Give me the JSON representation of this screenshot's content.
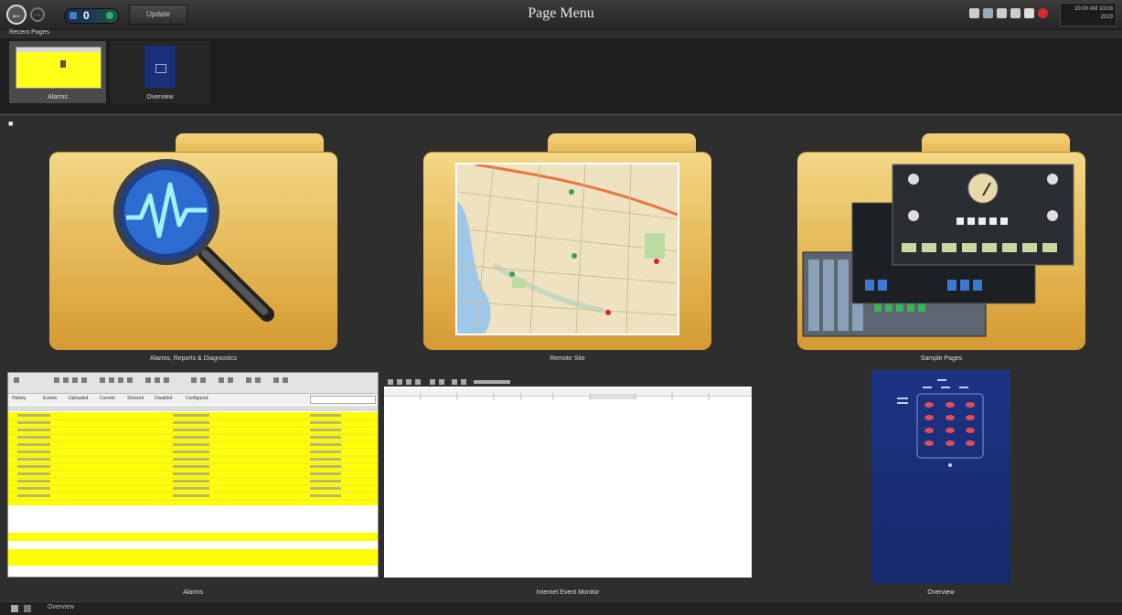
{
  "window": {
    "title": "Page Menu"
  },
  "toolbar": {
    "back_icon": "back-arrow-icon",
    "forward_icon": "forward-arrow-icon",
    "alarm_count": "0",
    "button_label": "Update"
  },
  "clock": {
    "time": "10:00 AM  10/18",
    "date": "2023"
  },
  "recent": {
    "label": "Recent Pages",
    "items": [
      {
        "label": "Alarms"
      },
      {
        "label": "Overview"
      }
    ]
  },
  "folders": [
    {
      "label": "Alarms, Reports & Diagnostics",
      "icon": "magnifier-icon"
    },
    {
      "label": "Remote Site",
      "icon": "map-icon"
    },
    {
      "label": "Sample Pages",
      "icon": "control-panel-icon"
    }
  ],
  "pages": [
    {
      "label": "Alarms"
    },
    {
      "label": "Internet Event Monitor"
    },
    {
      "label": "Overview"
    }
  ],
  "alarm_table": {
    "tabs": [
      "History",
      "Events",
      "Uploaded",
      "Current",
      "Shelved",
      "Disabled",
      "Configured"
    ]
  },
  "statusbar": {
    "label": "Overview"
  },
  "colors": {
    "alarm_row": "#ffff00",
    "folder": "#e8bf5c",
    "overview_bg": "#1a2f7a"
  }
}
